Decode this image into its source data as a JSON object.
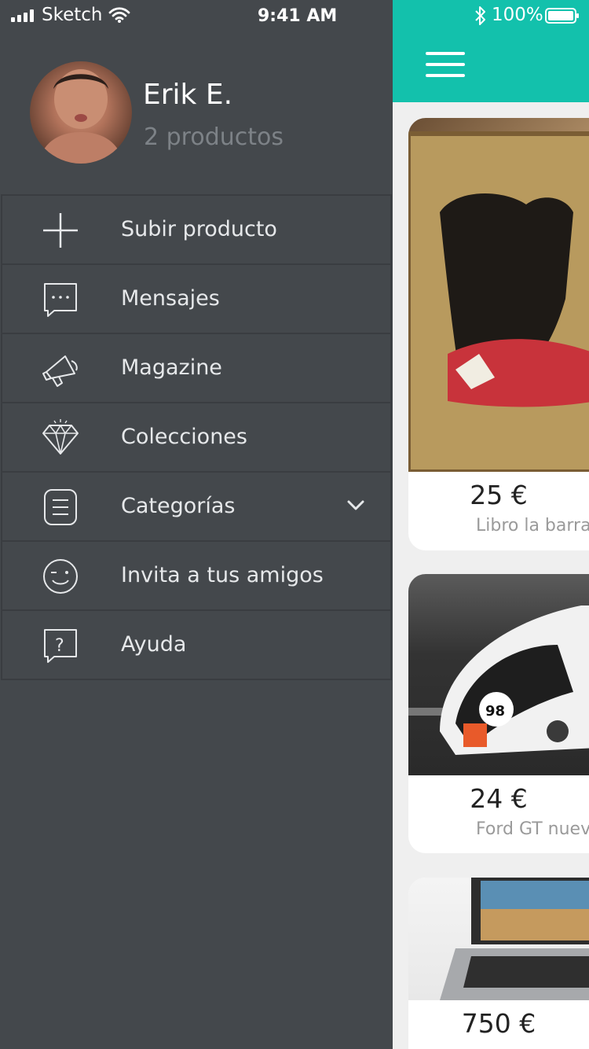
{
  "status_bar": {
    "carrier": "Sketch",
    "time": "9:41 AM",
    "battery": "100%"
  },
  "profile": {
    "name": "Erik E.",
    "products": "2 productos"
  },
  "menu": [
    {
      "label": "Subir producto",
      "icon": "plus-icon"
    },
    {
      "label": "Mensajes",
      "icon": "chat-bubble-icon"
    },
    {
      "label": "Magazine",
      "icon": "megaphone-icon"
    },
    {
      "label": "Colecciones",
      "icon": "diamond-icon"
    },
    {
      "label": "Categorías",
      "icon": "list-icon",
      "expandable": true
    },
    {
      "label": "Invita a tus amigos",
      "icon": "wink-face-icon"
    },
    {
      "label": "Ayuda",
      "icon": "help-icon"
    }
  ],
  "products": [
    {
      "price": "25 €",
      "title": "Libro la barra"
    },
    {
      "price": "24 €",
      "title": "Ford GT nuev"
    },
    {
      "price": "750 €",
      "title": ""
    }
  ],
  "colors": {
    "drawer_bg": "#44484c",
    "accent": "#13c1ac",
    "divider": "#3a3d41",
    "muted_text": "#7d8287"
  }
}
